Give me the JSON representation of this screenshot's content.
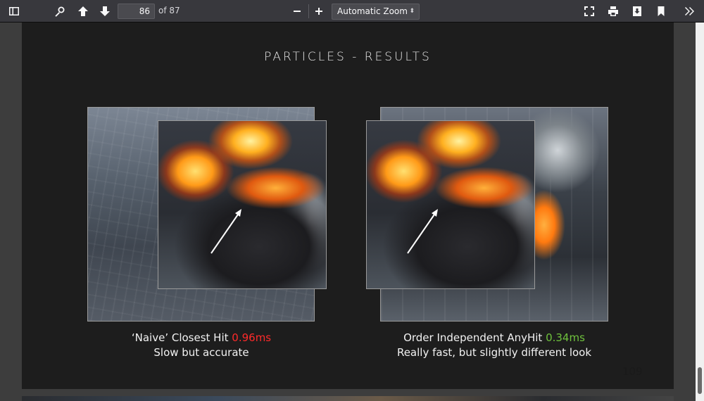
{
  "toolbar": {
    "page_number": "86",
    "page_count_label": "of 87",
    "zoom_label": "Automatic Zoom"
  },
  "slide": {
    "title": "PARTICLES - RESULTS",
    "left_caption": {
      "line1_text": "‘Naive’ Closest Hit",
      "line1_value": "0.96ms",
      "line2": "Slow but accurate",
      "value_color": "#ff2a2a"
    },
    "right_caption": {
      "line1_text": "Order Independent AnyHit",
      "line1_value": "0.34ms",
      "line2": "Really fast, but slightly different look",
      "value_color": "#6fc23d"
    },
    "page_number": "109"
  }
}
